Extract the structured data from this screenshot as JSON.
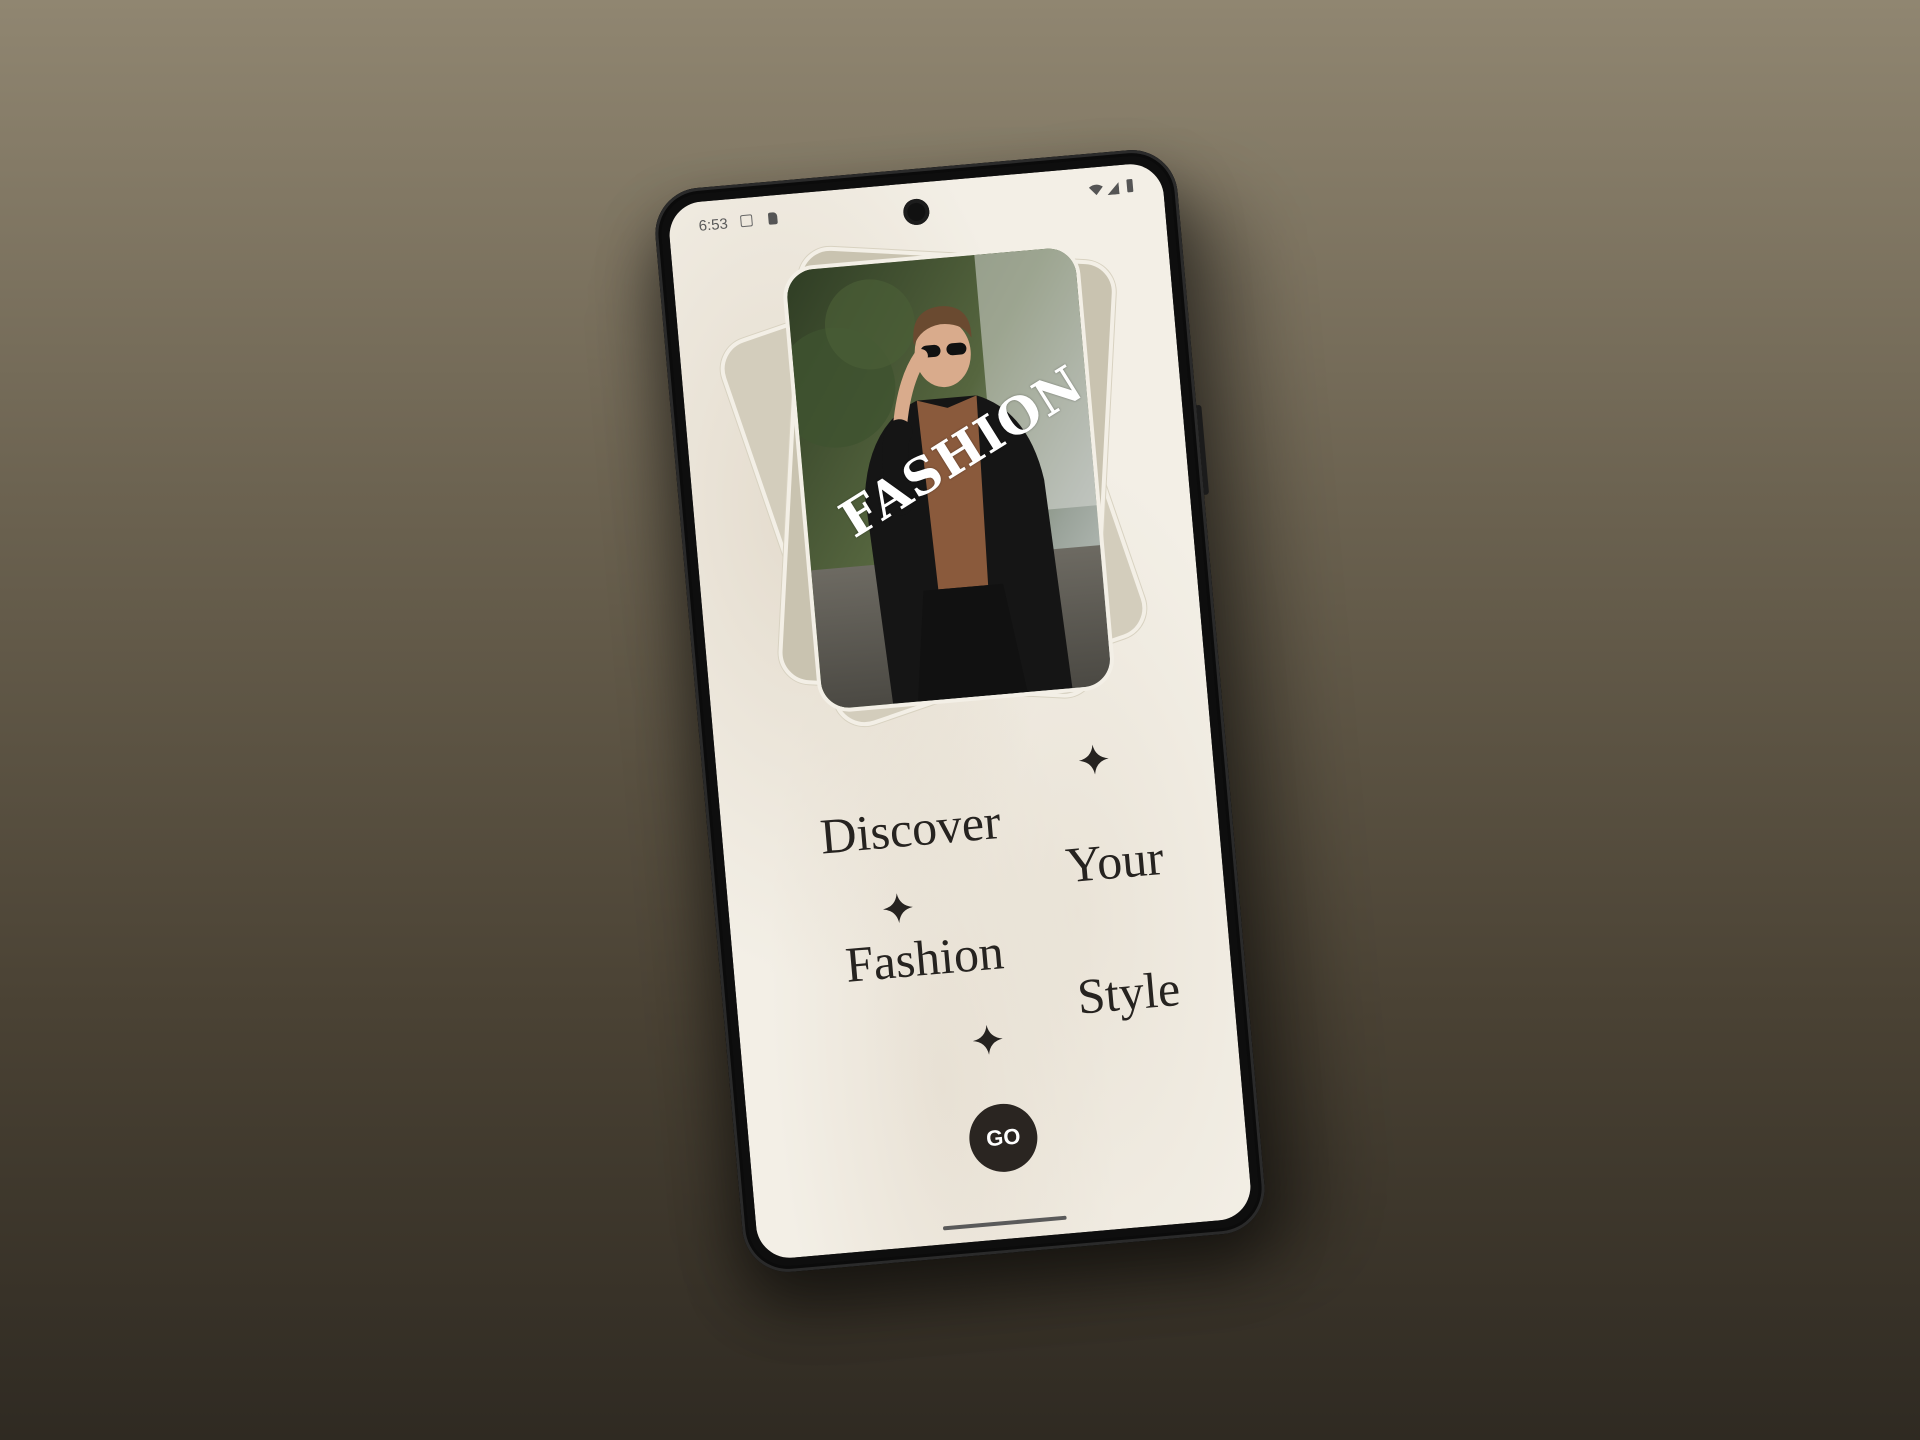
{
  "status_bar": {
    "time": "6:53",
    "left_icons": [
      "screenshot-icon",
      "sd-card-icon"
    ],
    "right_icons": [
      "wifi-icon",
      "signal-icon",
      "battery-icon"
    ]
  },
  "hero": {
    "overlay_word": "FASHION",
    "image": "man-in-sunglasses-and-black-blazer-photo"
  },
  "headline": {
    "words": [
      "Discover",
      "Your",
      "Fashion",
      "Style"
    ]
  },
  "cta": {
    "label": "GO"
  },
  "colors": {
    "screen_bg": "#f3efe6",
    "text_dark": "#262320",
    "button_bg": "#2a2521",
    "card_beige": "#cfc9b6"
  }
}
